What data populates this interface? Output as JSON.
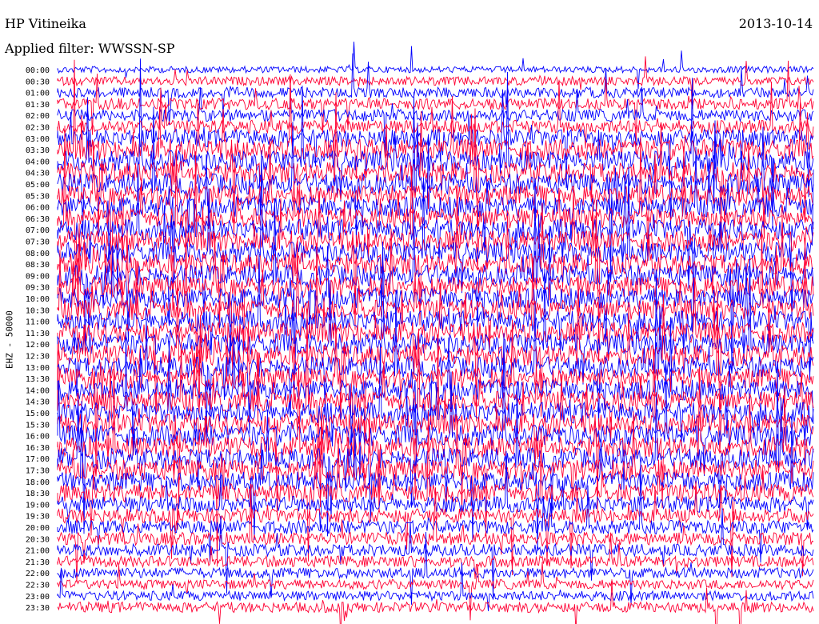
{
  "header": {
    "station": "HP Vitineika",
    "filter": "Applied filter: WWSSN-SP",
    "date": "2013-10-14"
  },
  "chart_data": {
    "type": "line",
    "title": "HP Vitineika",
    "subtitle": "Applied filter: WWSSN-SP",
    "date": "2013-10-14",
    "ylabel": "EHZ - 50000",
    "row_labels": [
      "00:00",
      "00:30",
      "01:00",
      "01:30",
      "02:00",
      "02:30",
      "03:00",
      "03:30",
      "04:00",
      "04:30",
      "05:00",
      "05:30",
      "06:00",
      "06:30",
      "07:00",
      "07:30",
      "08:00",
      "08:30",
      "09:00",
      "09:30",
      "10:00",
      "10:30",
      "11:00",
      "11:30",
      "12:00",
      "12:30",
      "13:00",
      "13:30",
      "14:00",
      "14:30",
      "15:00",
      "15:30",
      "16:00",
      "16:30",
      "17:00",
      "17:30",
      "18:00",
      "18:30",
      "19:00",
      "19:30",
      "20:00",
      "20:30",
      "21:00",
      "21:30",
      "22:00",
      "22:30",
      "23:00",
      "23:30"
    ],
    "trace_minutes": 30,
    "trace_colors": [
      "#0000ff",
      "#ff0033"
    ],
    "activity_level": [
      0.1,
      0.25,
      0.35,
      0.4,
      0.45,
      0.55,
      0.8,
      1.0,
      1.0,
      1.0,
      1.0,
      1.0,
      1.0,
      1.0,
      1.0,
      1.0,
      1.0,
      1.0,
      1.0,
      1.0,
      1.0,
      1.0,
      1.0,
      1.0,
      1.0,
      1.0,
      1.0,
      1.0,
      1.0,
      1.0,
      1.0,
      1.0,
      1.0,
      1.0,
      1.0,
      1.0,
      0.9,
      0.85,
      0.7,
      0.6,
      0.55,
      0.5,
      0.45,
      0.4,
      0.35,
      0.3,
      0.3,
      0.35
    ],
    "grid": false
  }
}
